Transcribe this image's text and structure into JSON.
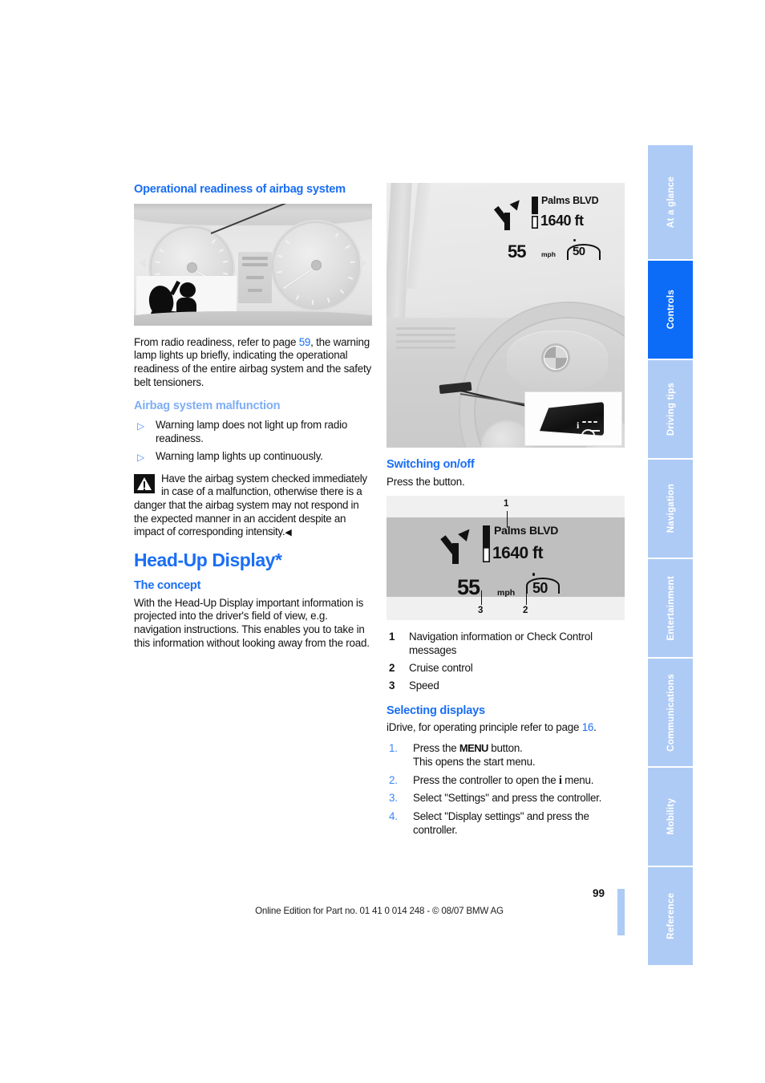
{
  "document": {
    "page_number": "99",
    "edition_line": "Online Edition for Part no. 01 41 0 014 248 - © 08/07 BMW AG"
  },
  "tabs": [
    {
      "label": "At a glance",
      "active": false
    },
    {
      "label": "Controls",
      "active": true
    },
    {
      "label": "Driving tips",
      "active": false
    },
    {
      "label": "Navigation",
      "active": false
    },
    {
      "label": "Entertainment",
      "active": false
    },
    {
      "label": "Communications",
      "active": false
    },
    {
      "label": "Mobility",
      "active": false
    },
    {
      "label": "Reference",
      "active": false
    }
  ],
  "left_column": {
    "heading": "Operational readiness of airbag system",
    "intro_before_link": "From radio readiness, refer to page ",
    "intro_link": "59",
    "intro_after_link": ", the warning lamp lights up briefly, indicating the operational readiness of the entire airbag system and the safety belt tensioners.",
    "malfunction_heading": "Airbag system malfunction",
    "malfunction_items": [
      "Warning lamp does not light up from radio readiness.",
      "Warning lamp lights up continuously."
    ],
    "bullet_glyph": "▷",
    "warning_text": "Have the airbag system checked immediately in case of a malfunction, otherwise there is a danger that the airbag system may not respond in the expected manner in an accident despite an impact of corresponding intensity.",
    "warning_endmark": "◀",
    "chapter_heading": "Head-Up Display*",
    "concept_heading": "The concept",
    "concept_text": "With the Head-Up Display important information is projected into the driver's field of view, e.g. navigation instructions. This enables you to take in this information without looking away from the road."
  },
  "right_column": {
    "switching_heading": "Switching on/off",
    "switching_text": "Press the button.",
    "legend": [
      {
        "number": "1",
        "text": "Navigation information or Check Control messages"
      },
      {
        "number": "2",
        "text": "Cruise control"
      },
      {
        "number": "3",
        "text": "Speed"
      }
    ],
    "selecting_heading": "Selecting displays",
    "selecting_intro_before_link": "iDrive, for operating principle refer to page ",
    "selecting_intro_link": "16",
    "selecting_intro_after_link": ".",
    "steps": [
      {
        "number": "1.",
        "pre": "Press the ",
        "kbd": "MENU",
        "post": " button.",
        "second_line": "This opens the start menu."
      },
      {
        "number": "2.",
        "pre": "Press the controller to open the ",
        "kbd": "i",
        "post": " menu.",
        "second_line": ""
      },
      {
        "number": "3.",
        "pre": "Select \"Settings\" and press the controller.",
        "kbd": "",
        "post": "",
        "second_line": ""
      },
      {
        "number": "4.",
        "pre": "Select \"Display settings\" and press the controller.",
        "kbd": "",
        "post": "",
        "second_line": ""
      }
    ]
  },
  "hud_display": {
    "street": "Palms BLVD",
    "distance": "1640 ft",
    "speed": "55",
    "speed_unit": "mph",
    "cruise_control": "50",
    "callouts": [
      "1",
      "2",
      "3"
    ]
  },
  "colors": {
    "heading_blue": "#1a6ef5",
    "subheading_light_blue": "#7faef5",
    "link_blue": "#1a6ef5",
    "tab_inactive": "#aecbf5",
    "tab_active": "#0d6cf7",
    "body_text": "#121212"
  }
}
